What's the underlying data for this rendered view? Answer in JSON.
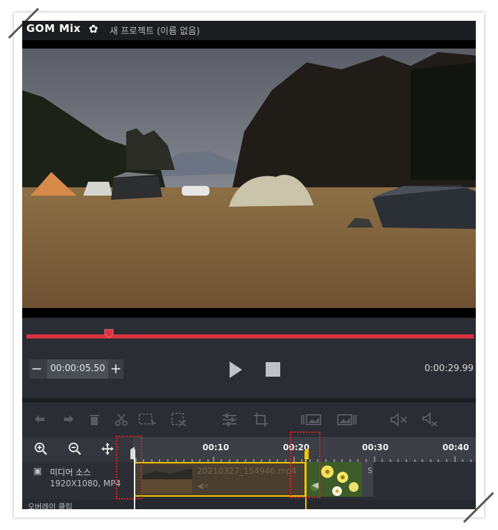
{
  "app": {
    "logo": "GOM Mix",
    "project_title": "새 프로젝트 (이름 없음)"
  },
  "playback": {
    "current_time": "00:00:05.50",
    "duration": "0:00:29.99",
    "minus_label": "−",
    "plus_label": "+",
    "progress_fraction": 0.18
  },
  "toolbar_icons": [
    "undo-icon",
    "redo-icon",
    "delete-icon",
    "cut-icon",
    "select-icon",
    "split-icon",
    "adjust-icon",
    "crop-icon",
    "freeze-frame-icon",
    "image-icon",
    "mute-icon",
    "detach-audio-icon"
  ],
  "timeline": {
    "ruler_labels": [
      "00:10",
      "00:20",
      "00:30",
      "00:40"
    ],
    "track_label": "미디어 소스",
    "track_sub": "1920X1080, MP4",
    "clip_name": "20210327_154946.mp4",
    "clip_mute_glyph": "◀×",
    "clip2_tail": "S",
    "overlay_label": "오버레이 클립"
  },
  "colors": {
    "accent": "#d8323f",
    "clip_selected": "#f2c600",
    "annotation": "#e02020"
  }
}
